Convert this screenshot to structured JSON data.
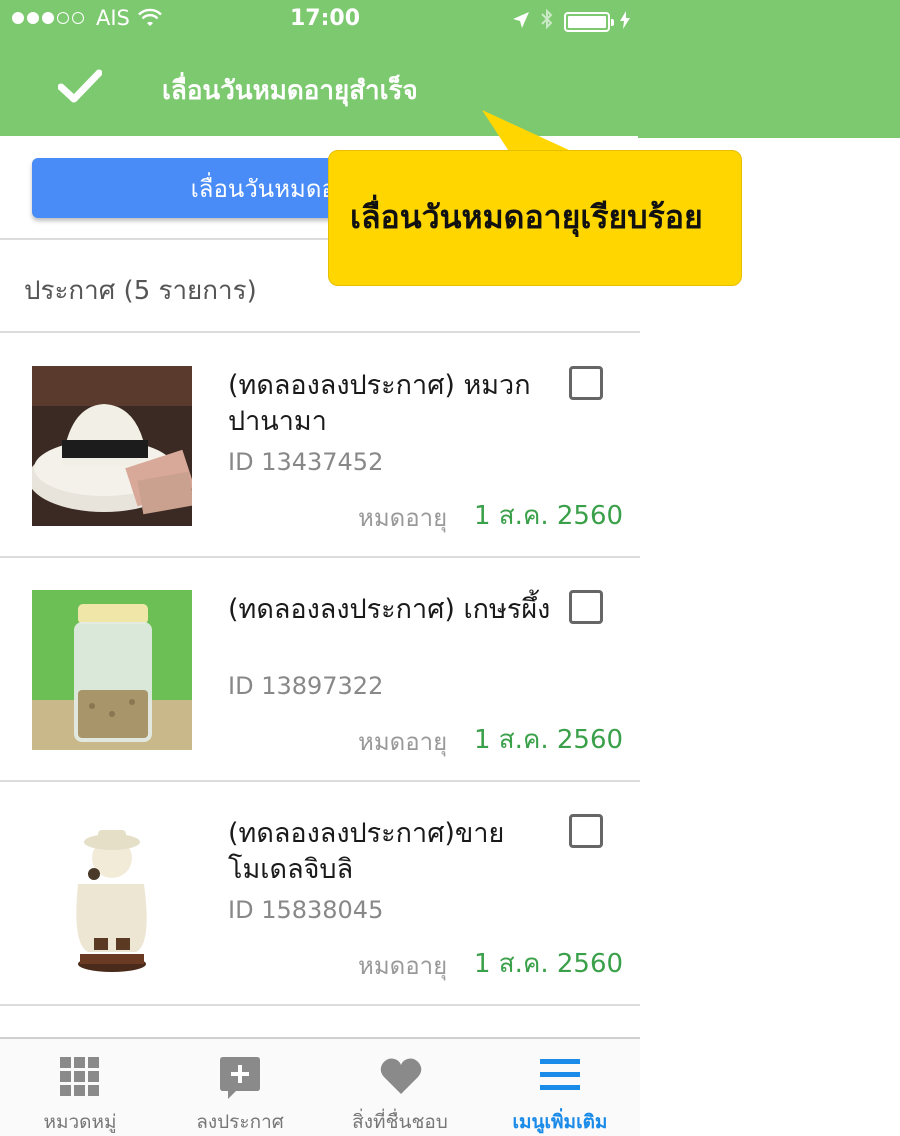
{
  "status_bar": {
    "carrier": "AIS",
    "time": "17:00"
  },
  "toast": {
    "message": "เลื่อนวันหมดอายุสำเร็จ",
    "icon": "checkmark-icon"
  },
  "action_button": {
    "label": "เลื่อนวันหมดอายุ"
  },
  "section": {
    "title": "ประกาศ (5 รายการ)"
  },
  "listings": [
    {
      "title": "(ทดลองลงประกาศ) หมวกปานามา",
      "id_text": "ID 13437452",
      "expiry_label": "หมดอายุ",
      "expiry_date": "1 ส.ค. 2560",
      "image": "panama-hat-photo"
    },
    {
      "title": "(ทดลองลงประกาศ) เกษรผึ้ง",
      "id_text": "ID 13897322",
      "expiry_label": "หมดอายุ",
      "expiry_date": "1 ส.ค. 2560",
      "image": "bee-pollen-jar-photo"
    },
    {
      "title": "(ทดลองลงประกาศ)ขายโมเดลจิบลิ",
      "id_text": "ID 15838045",
      "expiry_label": "หมดอายุ",
      "expiry_date": "1 ส.ค. 2560",
      "image": "ghibli-figure-photo"
    }
  ],
  "tabbar": {
    "tabs": [
      {
        "label": "หมวดหมู่",
        "icon": "grid-icon",
        "active": false
      },
      {
        "label": "ลงประกาศ",
        "icon": "add-post-icon",
        "active": false
      },
      {
        "label": "สิ่งที่ชื่นชอบ",
        "icon": "heart-icon",
        "active": false
      },
      {
        "label": "เมนูเพิ่มเติม",
        "icon": "menu-icon",
        "active": true
      }
    ]
  },
  "callout": {
    "text": "เลื่อนวันหมดอายุเรียบร้อย"
  },
  "colors": {
    "toast_green": "#7dc970",
    "primary_blue": "#4a8cf7",
    "expiry_green": "#3aa04a",
    "active_tab_blue": "#1a8be8",
    "callout_yellow": "#ffd600"
  }
}
